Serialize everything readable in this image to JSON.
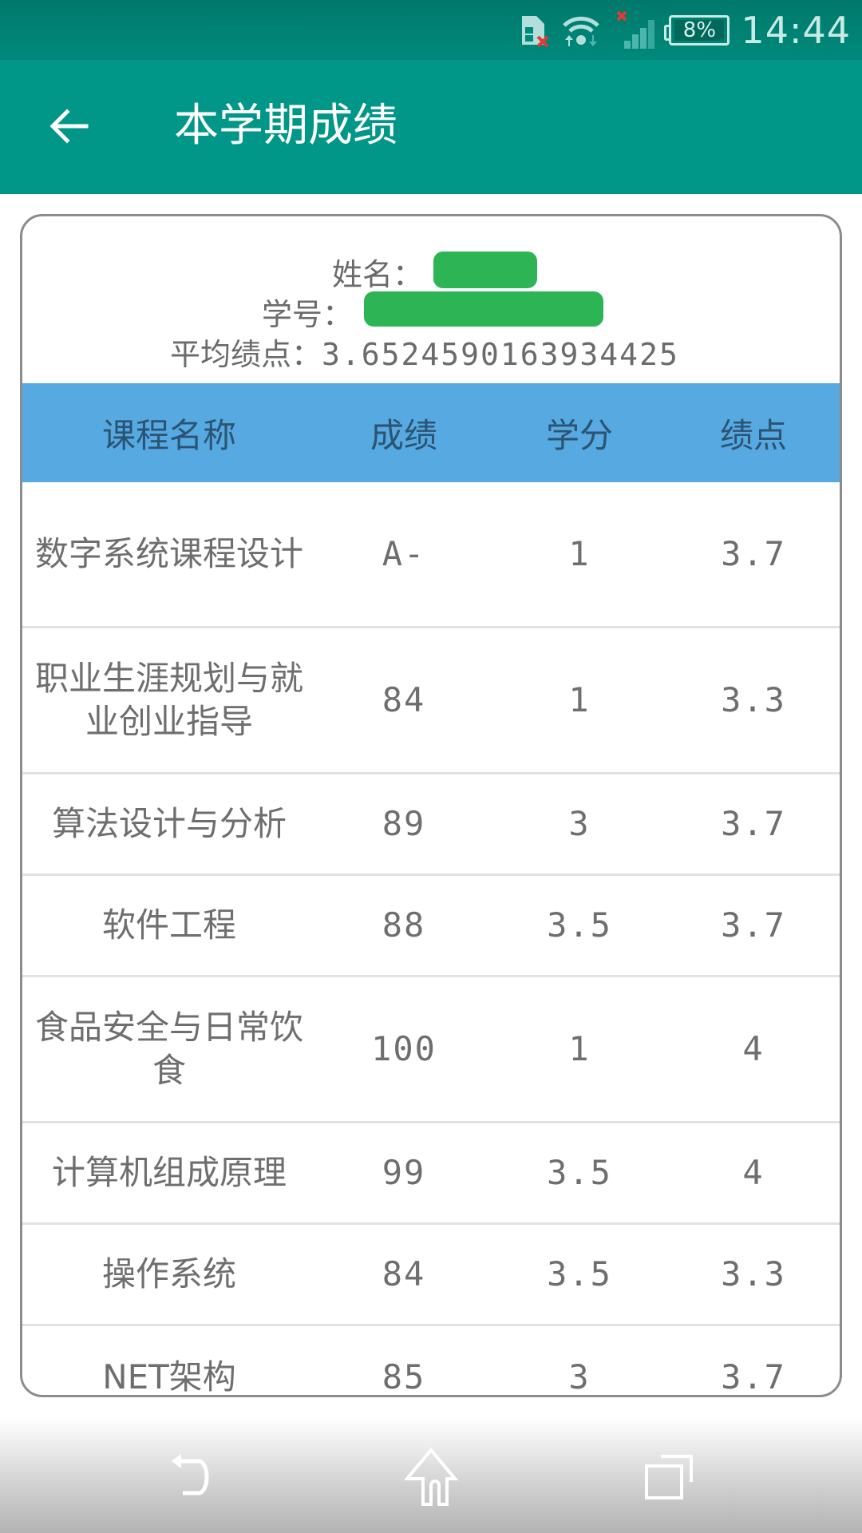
{
  "status_bar": {
    "time": "14:44",
    "battery_percent": "8%",
    "icons": [
      "sim-error-icon",
      "wifi-icon",
      "signal-no-service-icon",
      "battery-icon"
    ]
  },
  "app_bar": {
    "back_icon": "arrow-left-icon",
    "title": "本学期成绩"
  },
  "student_info": {
    "name_label": "姓名：",
    "name_value": "[redacted]",
    "id_label": "学号：",
    "id_value": "[redacted]",
    "gpa_label": "平均绩点：",
    "gpa_value": "3.6524590163934425"
  },
  "table": {
    "headers": [
      "课程名称",
      "成绩",
      "学分",
      "绩点"
    ],
    "header_bg": "#57a9e2",
    "rows": [
      {
        "course": "数字系统课程设计",
        "score": "A-",
        "credit": "1",
        "gpa": "3.7"
      },
      {
        "course": "职业生涯规划与就业创业指导",
        "score": "84",
        "credit": "1",
        "gpa": "3.3"
      },
      {
        "course": "算法设计与分析",
        "score": "89",
        "credit": "3",
        "gpa": "3.7"
      },
      {
        "course": "软件工程",
        "score": "88",
        "credit": "3.5",
        "gpa": "3.7"
      },
      {
        "course": "食品安全与日常饮食",
        "score": "100",
        "credit": "1",
        "gpa": "4"
      },
      {
        "course": "计算机组成原理",
        "score": "99",
        "credit": "3.5",
        "gpa": "4"
      },
      {
        "course": "操作系统",
        "score": "84",
        "credit": "3.5",
        "gpa": "3.3"
      },
      {
        "course": "NET架构",
        "score": "85",
        "credit": "3",
        "gpa": "3.7"
      }
    ]
  },
  "nav_bar": {
    "back": "nav-back-icon",
    "home": "nav-home-icon",
    "recents": "nav-recents-icon"
  },
  "colors": {
    "primary": "#009688",
    "status_bar": "#00796b",
    "text": "#6e6e6e"
  }
}
